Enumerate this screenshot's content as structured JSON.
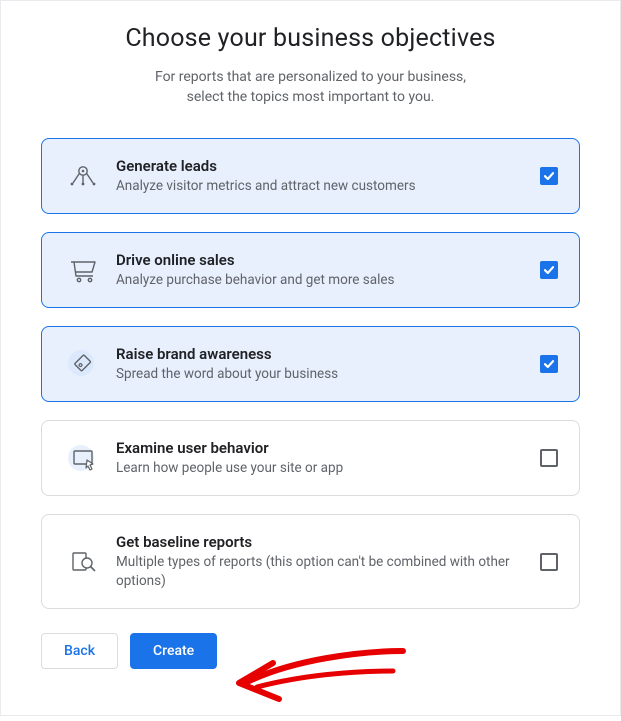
{
  "header": {
    "title": "Choose your business objectives",
    "subtitle_line1": "For reports that are personalized to your business,",
    "subtitle_line2": "select the topics most important to you."
  },
  "options": [
    {
      "id": "generate-leads",
      "title": "Generate leads",
      "description": "Analyze visitor metrics and attract new customers",
      "selected": true,
      "icon": "leads-icon"
    },
    {
      "id": "drive-online-sales",
      "title": "Drive online sales",
      "description": "Analyze purchase behavior and get more sales",
      "selected": true,
      "icon": "cart-icon"
    },
    {
      "id": "raise-brand-awareness",
      "title": "Raise brand awareness",
      "description": "Spread the word about your business",
      "selected": true,
      "icon": "tag-icon"
    },
    {
      "id": "examine-user-behavior",
      "title": "Examine user behavior",
      "description": "Learn how people use your site or app",
      "selected": false,
      "icon": "behavior-icon"
    },
    {
      "id": "get-baseline-reports",
      "title": "Get baseline reports",
      "description": "Multiple types of reports (this option can't be combined with other options)",
      "selected": false,
      "icon": "magnifier-icon"
    }
  ],
  "buttons": {
    "back": "Back",
    "create": "Create"
  },
  "colors": {
    "primary": "#1a73e8",
    "selected_bg": "#e8f0fe",
    "border": "#dadce0",
    "text_secondary": "#5f6368",
    "annotation_arrow": "#e60000"
  }
}
